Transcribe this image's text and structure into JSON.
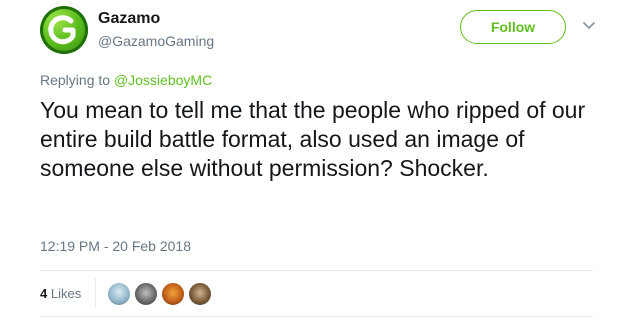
{
  "account": {
    "display_name": "Gazamo",
    "handle": "@GazamoGaming",
    "avatar_icon": "gazamo-logo-icon",
    "accent_color": "#5fbf1f"
  },
  "header": {
    "follow_label": "Follow",
    "menu_icon": "chevron-down-icon"
  },
  "reply": {
    "prefix": "Replying to",
    "mention": "@JossieboyMC"
  },
  "tweet": {
    "text": "You mean to tell me that the people who ripped of our entire build battle format, also used an image of someone else without permission? Shocker.",
    "timestamp": "12:19 PM - 20 Feb 2018"
  },
  "stats": {
    "likes_count": "4",
    "likes_label": "Likes"
  }
}
